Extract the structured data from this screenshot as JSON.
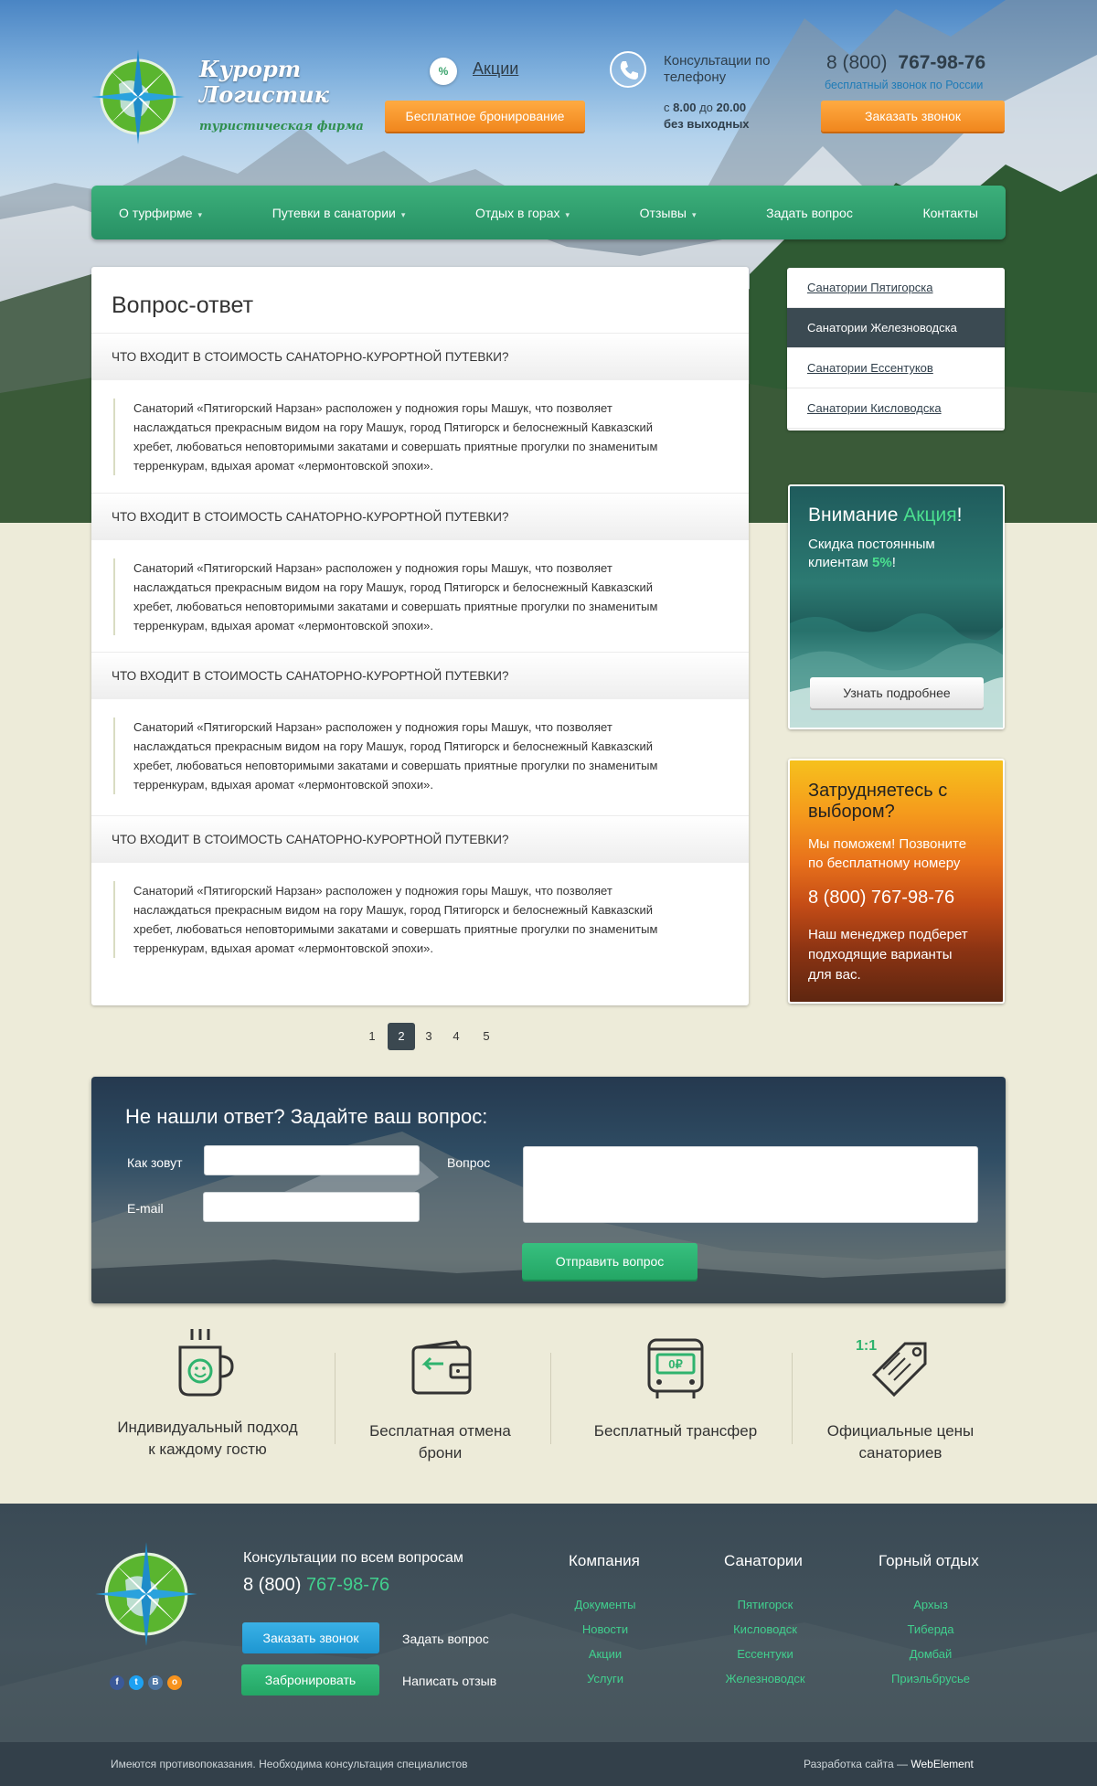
{
  "header": {
    "logo_line1": "Курорт",
    "logo_line2": "Логистик",
    "logo_sub": "туристическая фирма",
    "promo_icon": "%",
    "promo_link": "Акции",
    "free_booking": "Бесплатное бронирование",
    "consult_title": "Консультации по телефону",
    "hours_prefix": "с",
    "hours_from": "8.00",
    "hours_to_word": "до",
    "hours_to": "20.00",
    "hours_days": "без выходных",
    "phone_code": "8 (800)",
    "phone_num": "767-98-76",
    "phone_note": "бесплатный звонок по России",
    "callback": "Заказать звонок"
  },
  "nav": [
    {
      "label": "О турфирме",
      "arrow": true
    },
    {
      "label": "Путевки в санатории",
      "arrow": true
    },
    {
      "label": "Отдых в горах",
      "arrow": true
    },
    {
      "label": "Отзывы",
      "arrow": true
    },
    {
      "label": "Задать вопрос",
      "arrow": false
    },
    {
      "label": "Контакты",
      "arrow": false
    }
  ],
  "page_title": "Вопрос-ответ",
  "faq": [
    {
      "q": "ЧТО ВХОДИТ В СТОИМОСТЬ САНАТОРНО-КУРОРТНОЙ ПУТЕВКИ?",
      "a": [
        "Санаторий «Пятигорский Нарзан» расположен у подножия горы Машук, что позволяет",
        "наслаждаться  прекрасным видом на гору Машук, город Пятигорск и белоснежный Кавказский",
        "хребет, любоваться неповторимыми закатами и совершать приятные прогулки по знаменитым",
        "терренкурам, вдыхая аромат «лермонтовской эпохи»."
      ]
    },
    {
      "q": "ЧТО ВХОДИТ В СТОИМОСТЬ САНАТОРНО-КУРОРТНОЙ ПУТЕВКИ?",
      "a": [
        "Санаторий «Пятигорский Нарзан» расположен у подножия горы Машук, что позволяет",
        "наслаждаться  прекрасным видом на гору Машук, город Пятигорск и белоснежный Кавказский",
        "хребет, любоваться неповторимыми закатами и совершать приятные прогулки по знаменитым",
        "терренкурам, вдыхая аромат «лермонтовской эпохи»."
      ]
    },
    {
      "q": "ЧТО ВХОДИТ В СТОИМОСТЬ САНАТОРНО-КУРОРТНОЙ ПУТЕВКИ?",
      "a": [
        "Санаторий «Пятигорский Нарзан» расположен у подножия горы Машук, что позволяет",
        "наслаждаться  прекрасным видом на гору Машук, город Пятигорск и белоснежный Кавказский",
        "хребет, любоваться неповторимыми закатами и совершать приятные прогулки по знаменитым",
        "терренкурам, вдыхая аромат «лермонтовской эпохи»."
      ]
    },
    {
      "q": "ЧТО ВХОДИТ В СТОИМОСТЬ САНАТОРНО-КУРОРТНОЙ ПУТЕВКИ?",
      "a": [
        "Санаторий «Пятигорский Нарзан» расположен у подножия горы Машук, что позволяет",
        "наслаждаться  прекрасным видом на гору Машук, город Пятигорск и белоснежный Кавказский",
        "хребет, любоваться неповторимыми закатами и совершать приятные прогулки по знаменитым",
        "терренкурам, вдыхая аромат «лермонтовской эпохи»."
      ]
    }
  ],
  "sidebar": {
    "items": [
      "Санатории Пятигорска",
      "Санатории Железноводска",
      "Санатории Ессентуков",
      "Санатории Кисловодска"
    ],
    "active_index": 1
  },
  "promo": {
    "title_white": "Внимание ",
    "title_green": "Акция",
    "title_end": "!",
    "text1": "Скидка постоянным",
    "text2": "клиентам ",
    "discount": "5%",
    "text_end": "!",
    "button": "Узнать подробнее"
  },
  "help": {
    "title1": "Затрудняетесь с",
    "title2": "выбором?",
    "text1": "Мы поможем! Позвоните",
    "text2": "по бесплатному номеру",
    "phone": "8 (800) 767-98-76",
    "text3": "Наш менеджер подберет",
    "text4": "подходящие варианты",
    "text5": "для вас."
  },
  "pagination": {
    "pages": [
      "1",
      "2",
      "3",
      "4",
      "5"
    ],
    "active": "2"
  },
  "form": {
    "title": "Не нашли ответ? Задайте ваш вопрос:",
    "name_label": "Как зовут",
    "email_label": "E-mail",
    "question_label": "Вопрос",
    "submit": "Отправить вопрос"
  },
  "features": [
    {
      "line1": "Индивидуальный подход",
      "line2": "к каждому гостю",
      "icon": "cup-icon"
    },
    {
      "line1": "Бесплатная отмена",
      "line2": "брони",
      "icon": "wallet-icon"
    },
    {
      "line1": "Бесплатный трансфер",
      "line2": "",
      "icon": "bus-icon"
    },
    {
      "line1": "Официальные цены",
      "line2": "санаториев",
      "icon": "price-tag-icon",
      "badge": "1:1"
    }
  ],
  "footer": {
    "consult": "Консультации по всем вопросам",
    "phone_code": "8 (800)",
    "phone_num": "767-98-76",
    "callback": "Заказать звонок",
    "ask": "Задать вопрос",
    "book": "Забронировать",
    "review": "Написать отзыв",
    "social": [
      "f",
      "t",
      "B",
      "o"
    ],
    "col1_title": "Компания",
    "col1": [
      "Документы",
      "Новости",
      "Акции",
      "Услуги"
    ],
    "col2_title": "Санатории",
    "col2": [
      "Пятигорск",
      "Кисловодск",
      "Ессентуки",
      "Железноводск"
    ],
    "col3_title": "Горный отдых",
    "col3": [
      "Архыз",
      "Тиберда",
      "Домбай",
      "Приэльбрусье"
    ],
    "disclaimer": "Имеются противопоказания. Необходима консультация специалистов",
    "dev_prefix": "Разработка сайта — ",
    "dev_name": "WebElement"
  },
  "colors": {
    "accent_green": "#2aa06a",
    "orange": "#f7941d",
    "dark": "#3b4850",
    "link_green": "#41d08e",
    "blue": "#1d96d1"
  }
}
